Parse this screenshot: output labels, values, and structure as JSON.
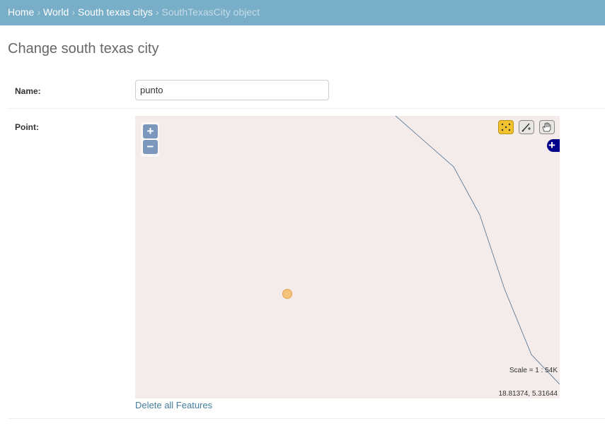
{
  "breadcrumbs": {
    "home": "Home",
    "world": "World",
    "model": "South texas citys",
    "current": "SouthTexasCity object",
    "separator": "›"
  },
  "page_title": "Change south texas city",
  "form": {
    "name_label": "Name:",
    "name_value": "punto",
    "point_label": "Point:"
  },
  "map": {
    "zoom_in": "+",
    "zoom_out": "−",
    "layer_switcher": "+",
    "scale_text": "Scale = 1 : 54K",
    "coordinates": "18.81374, 5.31644",
    "tools": [
      "select-points-icon",
      "draw-point-icon",
      "pan-hand-icon"
    ],
    "active_tool": "select-points-icon",
    "colors": {
      "background": "#f4ebeb",
      "boundary_line": "#4a6d8c",
      "point_fill": "#f6c27a",
      "zoom_buttons": "#7b98bc",
      "active_tool": "#f2c22e",
      "layer_switcher": "#00008b"
    }
  },
  "delete_link": "Delete all Features",
  "colors": {
    "header_bar": "#79aec8",
    "link": "#447e9b"
  }
}
